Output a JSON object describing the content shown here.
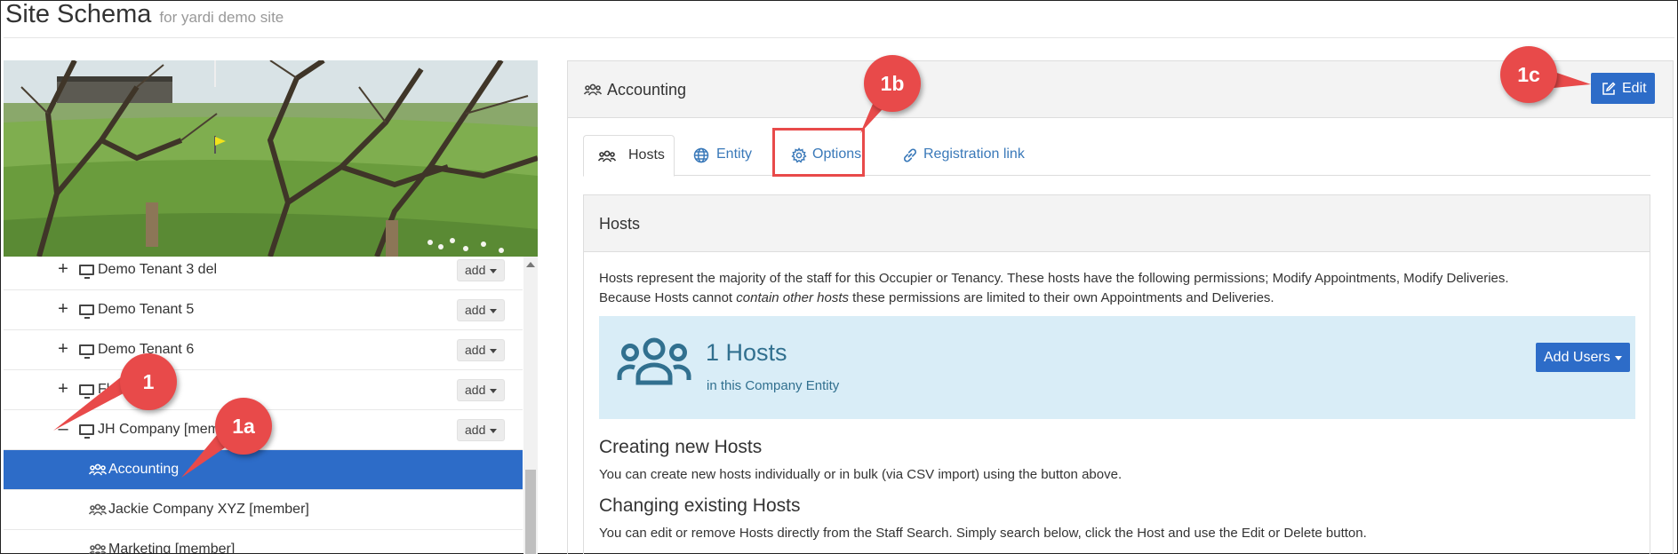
{
  "header": {
    "title": "Site Schema",
    "subtitle": "for yardi demo site"
  },
  "tree": {
    "add_label": "add",
    "rows": [
      {
        "label": "Demo Tenant 3 del",
        "toggle": "+"
      },
      {
        "label": "Demo Tenant 5",
        "toggle": "+"
      },
      {
        "label": "Demo Tenant 6",
        "toggle": "+"
      },
      {
        "label": "Fl",
        "toggle": "+"
      },
      {
        "label": "JH Company [mem",
        "toggle": "–"
      }
    ],
    "children": [
      {
        "label": "Accounting",
        "selected": true
      },
      {
        "label": "Jackie Company XYZ [member]"
      },
      {
        "label": "Marketing [member]"
      }
    ]
  },
  "panel": {
    "title": "Accounting",
    "edit_label": "Edit",
    "tabs": [
      {
        "label": "Hosts",
        "icon": "users-icon",
        "active": true
      },
      {
        "label": "Entity",
        "icon": "globe-icon"
      },
      {
        "label": "Options",
        "icon": "gear-icon"
      },
      {
        "label": "Registration link",
        "icon": "link-icon"
      }
    ]
  },
  "hosts": {
    "heading": "Hosts",
    "desc_line1": "Hosts represent the majority of the staff for this Occupier or Tenancy. These hosts have the following permissions; Modify Appointments, Modify Deliveries.",
    "desc_line2_a": "Because Hosts cannot ",
    "desc_line2_em": "contain other hosts",
    "desc_line2_b": " these permissions are limited to their own Appointments and Deliveries.",
    "count_title": "1 Hosts",
    "count_sub": "in this Company Entity",
    "add_users_label": "Add Users",
    "creating_title": "Creating new Hosts",
    "creating_text": "You can create new hosts individually or in bulk (via CSV import) using the button above.",
    "changing_title": "Changing existing Hosts",
    "changing_text": "You can edit or remove Hosts directly from the Staff Search. Simply search below, click the Host and use the Edit or Delete button."
  },
  "callouts": {
    "c1": "1",
    "c1a": "1a",
    "c1b": "1b",
    "c1c": "1c"
  },
  "colors": {
    "primary": "#2d6cc8",
    "callout": "#e84a4a",
    "info_bg": "#d9edf7",
    "info_text": "#31708f",
    "link": "#3a79b9"
  }
}
